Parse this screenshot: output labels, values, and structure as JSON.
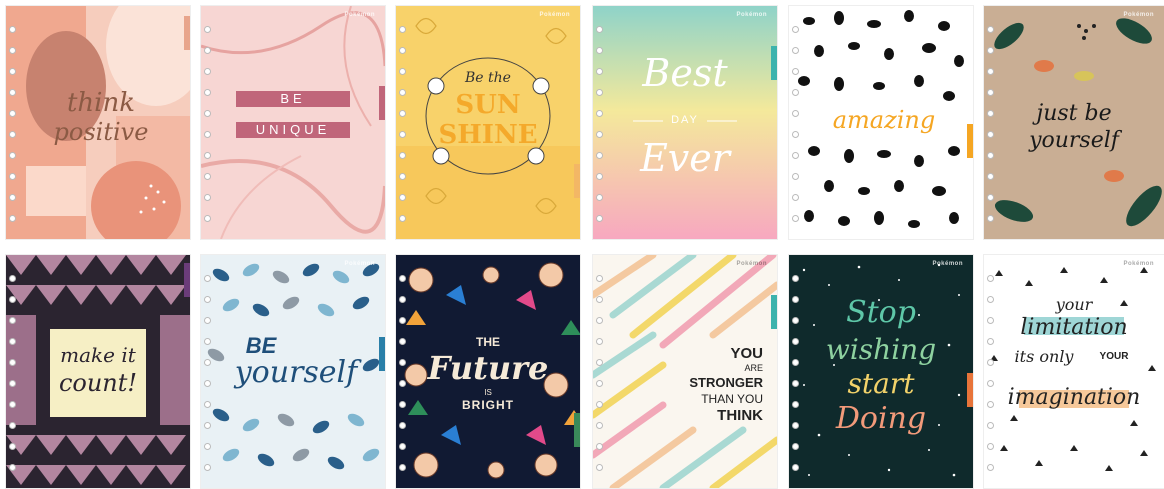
{
  "brand": "Pokémon",
  "covers": {
    "c1": {
      "line1": "think",
      "line2": "positive"
    },
    "c2": {
      "line1": "BE",
      "line2": "UNIQUE"
    },
    "c3": {
      "line1": "Be the",
      "line2": "SUN",
      "line3": "SHINE"
    },
    "c4": {
      "line1": "Best",
      "line2": "DAY",
      "line3": "Ever"
    },
    "c5": {
      "line1": "amazing"
    },
    "c6": {
      "line1": "just be",
      "line2": "yourself"
    },
    "c7": {
      "line1": "make it",
      "line2": "count!"
    },
    "c8": {
      "line1": "BE",
      "line2": "yourself"
    },
    "c9": {
      "line1": "THE",
      "line2": "Future",
      "line3": "IS",
      "line4": "BRIGHT"
    },
    "c10": {
      "line1": "YOU",
      "line2": "ARE",
      "line3": "STRONGER",
      "line4": "THAN YOU",
      "line5": "THINK"
    },
    "c11": {
      "line1": "Stop",
      "line2": "wishing",
      "line3": "start",
      "line4": "Doing"
    },
    "c12": {
      "line1": "your",
      "line2": "limitation",
      "line3": "its only",
      "line4": "YOUR",
      "line5": "imagination"
    }
  },
  "colors": {
    "tab1": "#e8a58c",
    "tab2": "#c0667a",
    "tab3": "#f3b765",
    "tab4": "#3db3ad",
    "tab5": "#f5a623",
    "tab6": "#e07a4a",
    "tab7": "#6b3c7a",
    "tab8": "#2a7fa8",
    "tab9": "#3a8a5a",
    "tab10": "#3db3ad",
    "tab11": "#e8743a",
    "tab12": "#e8743a"
  }
}
